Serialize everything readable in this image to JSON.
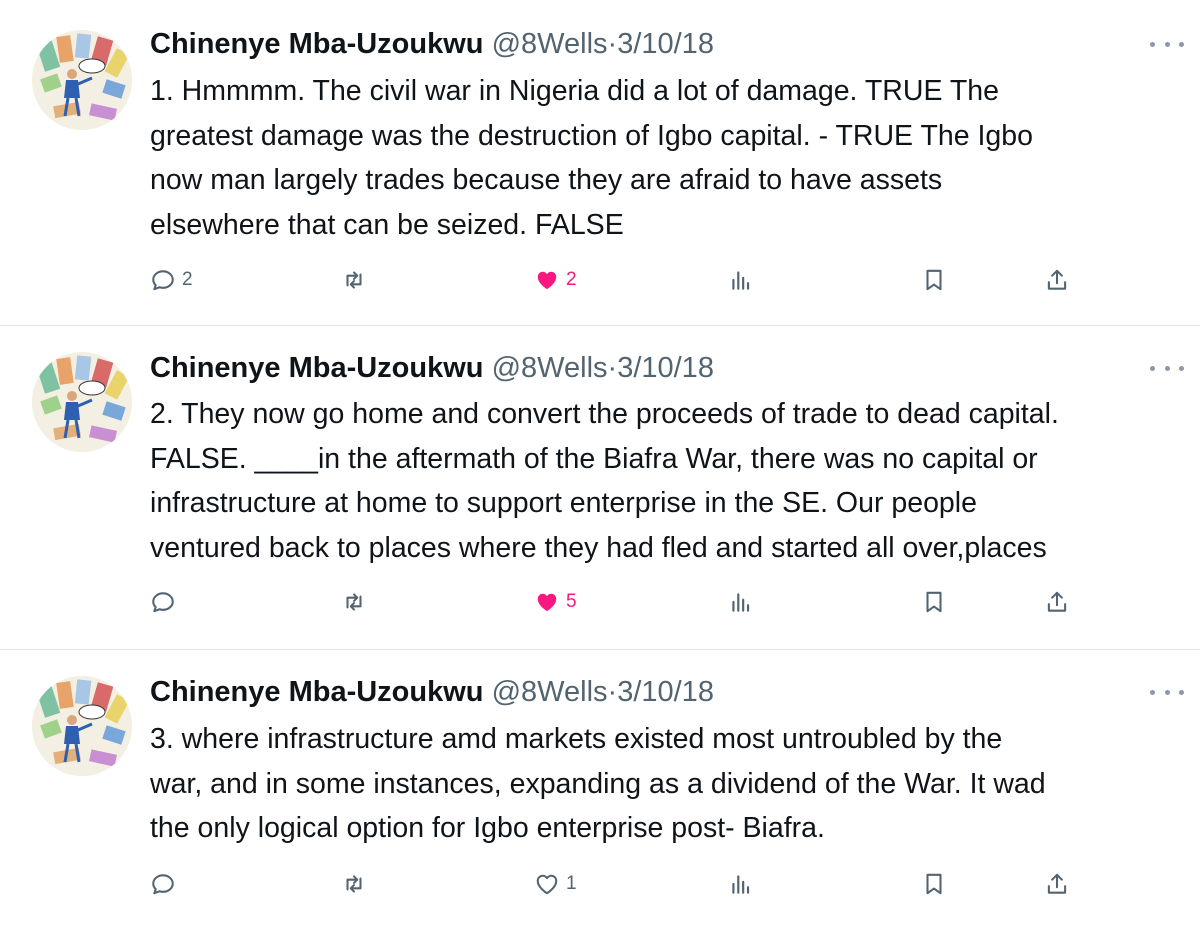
{
  "tweets": [
    {
      "author_name": "Chinenye Mba-Uzoukwu",
      "handle": "@8Wells",
      "separator": "·",
      "date": "3/10/18",
      "text": "1. Hmmmm. The civil war in Nigeria did a lot of damage. TRUE The\ngreatest damage was the destruction of Igbo capital. - TRUE The Igbo\nnow man largely trades because they are afraid to have assets\nelsewhere that can be seized. FALSE",
      "reply_count": "2",
      "retweet_count": "",
      "like_count": "2",
      "liked": true
    },
    {
      "author_name": "Chinenye Mba-Uzoukwu",
      "handle": "@8Wells",
      "separator": "·",
      "date": "3/10/18",
      "text": "2. They now go home and convert the proceeds of trade to dead capital.\nFALSE. ____in the aftermath of the Biafra War, there was no capital or\ninfrastructure at home to support enterprise in the SE. Our people\nventured back to places where they had fled and started all over,places",
      "reply_count": "",
      "retweet_count": "",
      "like_count": "5",
      "liked": true
    },
    {
      "author_name": "Chinenye Mba-Uzoukwu",
      "handle": "@8Wells",
      "separator": "·",
      "date": "3/10/18",
      "text": "3. where infrastructure amd markets existed most untroubled by the\nwar, and in some instances, expanding as a dividend of the War. It wad\nthe only logical option for Igbo enterprise post- Biafra.",
      "reply_count": "",
      "retweet_count": "",
      "like_count": "1",
      "liked": false
    }
  ],
  "icons": {
    "reply": "reply-icon",
    "retweet": "retweet-icon",
    "like": "heart-icon",
    "views": "views-icon",
    "bookmark": "bookmark-icon",
    "share": "share-icon",
    "more": "more-icon"
  },
  "colors": {
    "text": "#0f1419",
    "secondary": "#536471",
    "like_active": "#f91880",
    "divider": "#e3e7ea"
  }
}
